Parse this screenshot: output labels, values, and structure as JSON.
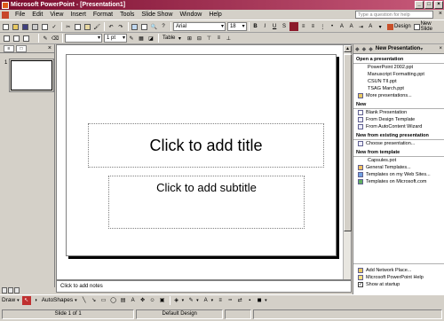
{
  "window": {
    "title": "Microsoft PowerPoint - [Presentation1]"
  },
  "menu": {
    "items": [
      "File",
      "Edit",
      "View",
      "Insert",
      "Format",
      "Tools",
      "Slide Show",
      "Window",
      "Help"
    ],
    "help_placeholder": "Type a question for help"
  },
  "toolbar": {
    "font_name": "Arial",
    "font_size": "18",
    "design_label": "Design",
    "new_slide_label": "New Slide",
    "table_label": "Table",
    "line_weight": "1 pt"
  },
  "slide": {
    "title_placeholder": "Click to add title",
    "subtitle_placeholder": "Click to add subtitle",
    "number": "1"
  },
  "notes": {
    "placeholder": "Click to add notes"
  },
  "taskpane": {
    "title": "New Presentation",
    "sections": {
      "open": {
        "heading": "Open a presentation",
        "files": [
          "PowerPoint 2002.ppt",
          "Manuscript Formatting.ppt",
          "CSUN TII.ppt",
          "TSAG March.ppt"
        ],
        "more": "More presentations..."
      },
      "new": {
        "heading": "New",
        "items": [
          "Blank Presentation",
          "From Design Template",
          "From AutoContent Wizard"
        ]
      },
      "existing": {
        "heading": "New from existing presentation",
        "items": [
          "Choose presentation..."
        ]
      },
      "template": {
        "heading": "New from template",
        "items": [
          "Capsules.pot",
          "General Templates...",
          "Templates on my Web Sites...",
          "Templates on Microsoft.com"
        ]
      }
    },
    "bottom": {
      "add_network": "Add Network Place...",
      "help": "Microsoft PowerPoint Help",
      "show_at_startup": "Show at startup"
    }
  },
  "drawbar": {
    "draw_label": "Draw",
    "autoshapes_label": "AutoShapes"
  },
  "status": {
    "slide": "Slide 1 of 1",
    "design": "Default Design"
  },
  "colors": {
    "titlebar_start": "#7a0c2e",
    "titlebar_end": "#c85a7a",
    "chrome": "#d4d0c8"
  }
}
